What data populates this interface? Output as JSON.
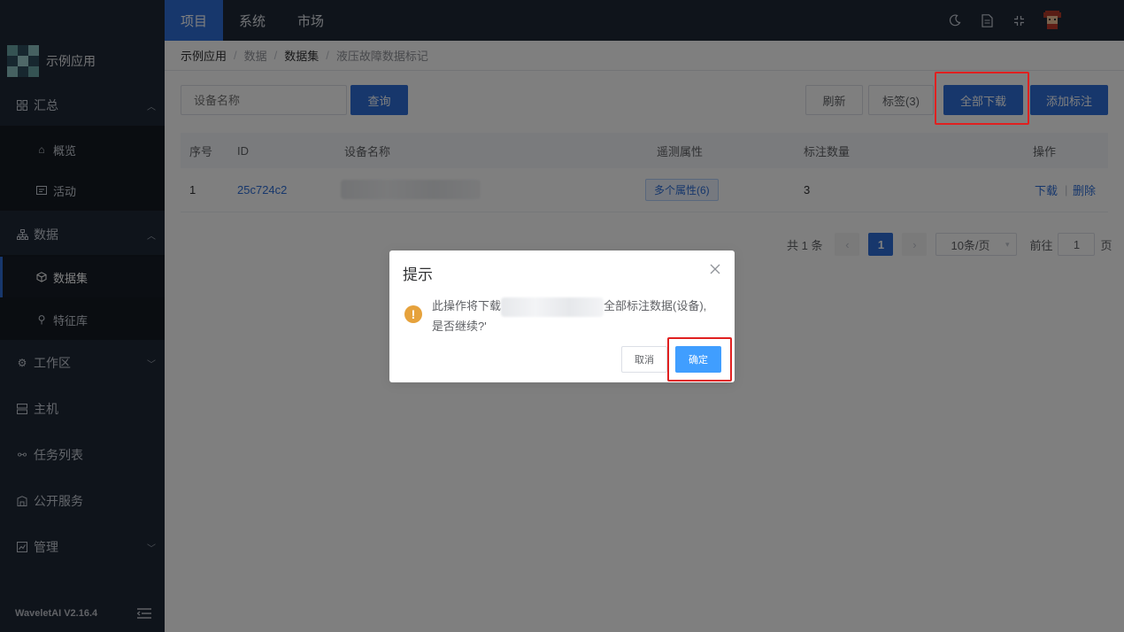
{
  "topbar": {
    "tabs": [
      {
        "label": "项目",
        "active": true
      },
      {
        "label": "系统",
        "active": false
      },
      {
        "label": "市场",
        "active": false
      }
    ]
  },
  "sidebar": {
    "app_name": "示例应用",
    "items": [
      {
        "label": "汇总",
        "icon": "grid-icon",
        "expanded": true
      },
      {
        "label": "概览",
        "icon": "home-icon"
      },
      {
        "label": "活动",
        "icon": "activity-icon"
      },
      {
        "label": "数据",
        "icon": "sitemap-icon",
        "expanded": true
      },
      {
        "label": "数据集",
        "icon": "cube-icon",
        "active": true
      },
      {
        "label": "特征库",
        "icon": "feature-icon"
      },
      {
        "label": "工作区",
        "icon": "gear-icon"
      },
      {
        "label": "主机",
        "icon": "server-icon"
      },
      {
        "label": "任务列表",
        "icon": "task-icon"
      },
      {
        "label": "公开服务",
        "icon": "building-icon"
      },
      {
        "label": "管理",
        "icon": "chart-icon"
      }
    ],
    "version": "WaveletAI V2.16.4"
  },
  "breadcrumb": [
    "示例应用",
    "数据",
    "数据集",
    "液压故障数据标记"
  ],
  "toolbar": {
    "search_placeholder": "设备名称",
    "query_label": "查询",
    "refresh_label": "刷新",
    "tags_label": "标签(3)",
    "download_all_label": "全部下载",
    "add_label_label": "添加标注"
  },
  "table": {
    "headers": [
      "序号",
      "ID",
      "设备名称",
      "遥测属性",
      "标注数量",
      "操作"
    ],
    "rows": [
      {
        "index": "1",
        "id": "25c724c2",
        "attr": "多个属性(6)",
        "count": "3",
        "download": "下载",
        "delete": "删除"
      }
    ]
  },
  "pagination": {
    "total": "共 1 条",
    "current": "1",
    "page_size": "10条/页",
    "goto_prefix": "前往",
    "goto_value": "1",
    "goto_suffix": "页"
  },
  "dialog": {
    "title": "提示",
    "message_part1": "此操作将下载",
    "message_part2": "全部标注数据(设备),",
    "message_part3": "是否继续?'",
    "cancel_label": "取消",
    "confirm_label": "确定"
  },
  "colors": {
    "accent": "#2f6fd8",
    "sidebar_bg": "#1f2937",
    "warning": "#e6a23c",
    "highlight": "#e02020"
  }
}
